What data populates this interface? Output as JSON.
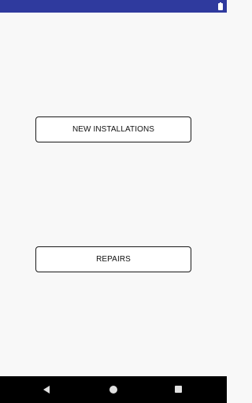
{
  "status_bar": {
    "color": "#2f3a9e",
    "icons": [
      "battery-icon"
    ]
  },
  "main": {
    "buttons": [
      {
        "label": "NEW INSTALLATIONS"
      },
      {
        "label": "REPAIRS"
      }
    ]
  },
  "nav_bar": {
    "icons": [
      "back-icon",
      "home-icon",
      "recents-icon"
    ]
  }
}
